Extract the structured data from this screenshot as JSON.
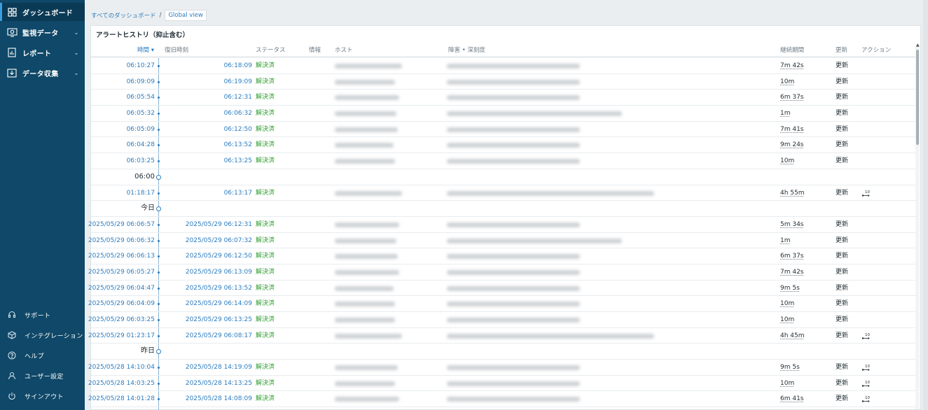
{
  "sidebar": {
    "items": [
      {
        "label": "ダッシュボード",
        "icon": "dashboard-icon",
        "chevron": ""
      },
      {
        "label": "監視データ",
        "icon": "monitoring-icon",
        "chevron": "⌄"
      },
      {
        "label": "レポート",
        "icon": "report-icon",
        "chevron": "⌄"
      },
      {
        "label": "データ収集",
        "icon": "data-collection-icon",
        "chevron": "⌄"
      }
    ],
    "bottom_items": [
      {
        "label": "サポート",
        "icon": "support-icon"
      },
      {
        "label": "インテグレーション",
        "icon": "integration-icon"
      },
      {
        "label": "ヘルプ",
        "icon": "help-icon"
      },
      {
        "label": "ユーザー設定",
        "icon": "user-icon"
      },
      {
        "label": "サインアウト",
        "icon": "signout-icon"
      }
    ]
  },
  "breadcrumb": {
    "root": "すべてのダッシュボード",
    "sep": "/",
    "current": "Global view"
  },
  "panel": {
    "title": "アラートヒストリ（抑止含む）",
    "columns": {
      "time": "時間 ▾",
      "recovery": "復旧時刻",
      "status": "ステータス",
      "info": "情報",
      "host": "ホスト",
      "problem": "障害 • 深刻度",
      "duration": "継続期間",
      "update": "更新",
      "actions": "アクション"
    },
    "rows": [
      {
        "time": "06:10:27",
        "recovery": "06:18:09",
        "status": "解決済",
        "duration": "7m 42s",
        "update": "更新",
        "action": "",
        "hw": 96,
        "pw": 190
      },
      {
        "time": "06:09:09",
        "recovery": "06:19:09",
        "status": "解決済",
        "duration": "10m",
        "update": "更新",
        "action": "",
        "hw": 86,
        "pw": 190
      },
      {
        "time": "06:05:54",
        "recovery": "06:12:31",
        "status": "解決済",
        "duration": "6m 37s",
        "update": "更新",
        "action": "",
        "hw": 92,
        "pw": 190
      },
      {
        "time": "06:05:32",
        "recovery": "06:06:32",
        "status": "解決済",
        "duration": "1m",
        "update": "更新",
        "action": "",
        "hw": 88,
        "pw": 250
      },
      {
        "time": "06:05:09",
        "recovery": "06:12:50",
        "status": "解決済",
        "duration": "7m 41s",
        "update": "更新",
        "action": "",
        "hw": 90,
        "pw": 190
      },
      {
        "time": "06:04:28",
        "recovery": "06:13:52",
        "status": "解決済",
        "duration": "9m 24s",
        "update": "更新",
        "action": "",
        "hw": 84,
        "pw": 190
      },
      {
        "time": "06:03:25",
        "recovery": "06:13:25",
        "status": "解決済",
        "duration": "10m",
        "update": "更新",
        "action": "",
        "hw": 86,
        "pw": 190
      },
      {
        "divider": "06:00"
      },
      {
        "time": "01:18:17",
        "recovery": "06:13:17",
        "status": "解決済",
        "duration": "4h 55m",
        "update": "更新",
        "action": "10",
        "hw": 96,
        "pw": 296
      },
      {
        "divider": "今日"
      },
      {
        "time": "2025/05/29 06:06:57",
        "recovery": "2025/05/29 06:12:31",
        "status": "解決済",
        "duration": "5m 34s",
        "update": "更新",
        "action": "",
        "hw": 92,
        "pw": 190
      },
      {
        "time": "2025/05/29 06:06:32",
        "recovery": "2025/05/29 06:07:32",
        "status": "解決済",
        "duration": "1m",
        "update": "更新",
        "action": "",
        "hw": 88,
        "pw": 250
      },
      {
        "time": "2025/05/29 06:06:13",
        "recovery": "2025/05/29 06:12:50",
        "status": "解決済",
        "duration": "6m 37s",
        "update": "更新",
        "action": "",
        "hw": 90,
        "pw": 190
      },
      {
        "time": "2025/05/29 06:05:27",
        "recovery": "2025/05/29 06:13:09",
        "status": "解決済",
        "duration": "7m 42s",
        "update": "更新",
        "action": "",
        "hw": 92,
        "pw": 190
      },
      {
        "time": "2025/05/29 06:04:47",
        "recovery": "2025/05/29 06:13:52",
        "status": "解決済",
        "duration": "9m 5s",
        "update": "更新",
        "action": "",
        "hw": 84,
        "pw": 190
      },
      {
        "time": "2025/05/29 06:04:09",
        "recovery": "2025/05/29 06:14:09",
        "status": "解決済",
        "duration": "10m",
        "update": "更新",
        "action": "",
        "hw": 86,
        "pw": 190
      },
      {
        "time": "2025/05/29 06:03:25",
        "recovery": "2025/05/29 06:13:25",
        "status": "解決済",
        "duration": "10m",
        "update": "更新",
        "action": "",
        "hw": 86,
        "pw": 190
      },
      {
        "time": "2025/05/29 01:23:17",
        "recovery": "2025/05/29 06:08:17",
        "status": "解決済",
        "duration": "4h 45m",
        "update": "更新",
        "action": "10",
        "hw": 96,
        "pw": 296
      },
      {
        "divider": "昨日"
      },
      {
        "time": "2025/05/28 14:10:04",
        "recovery": "2025/05/28 14:19:09",
        "status": "解決済",
        "duration": "9m 5s",
        "update": "更新",
        "action": "10",
        "hw": 90,
        "pw": 190
      },
      {
        "time": "2025/05/28 14:03:25",
        "recovery": "2025/05/28 14:13:25",
        "status": "解決済",
        "duration": "10m",
        "update": "更新",
        "action": "10",
        "hw": 86,
        "pw": 190
      },
      {
        "time": "2025/05/28 14:01:28",
        "recovery": "2025/05/28 14:08:09",
        "status": "解決済",
        "duration": "6m 41s",
        "update": "更新",
        "action": "10",
        "hw": 92,
        "pw": 190
      }
    ]
  }
}
